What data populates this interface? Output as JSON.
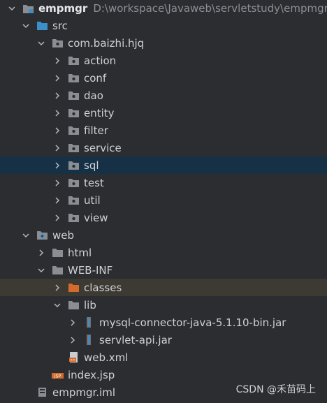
{
  "tree": {
    "project": {
      "label": "empmgr",
      "path": "D:\\workspace\\Javaweb\\servletstudy\\empmgr"
    },
    "src": {
      "label": "src"
    },
    "package": {
      "label": "com.baizhi.hjq"
    },
    "packages": [
      "action",
      "conf",
      "dao",
      "entity",
      "filter",
      "service",
      "sql",
      "test",
      "util",
      "view"
    ],
    "web": {
      "label": "web"
    },
    "html": {
      "label": "html"
    },
    "webinf": {
      "label": "WEB-INF"
    },
    "classes": {
      "label": "classes"
    },
    "lib": {
      "label": "lib"
    },
    "jars": [
      "mysql-connector-java-5.1.10-bin.jar",
      "servlet-api.jar"
    ],
    "webxml": {
      "label": "web.xml"
    },
    "indexjsp": {
      "label": "index.jsp"
    },
    "iml": {
      "label": "empmgr.iml"
    }
  },
  "watermark": "CSDN @禾苗码上",
  "colors": {
    "background": "#2b2d30",
    "selected_row": "#163046",
    "highlighted_row": "#3d3a34",
    "folder": "#8a8d92",
    "source_folder": "#3c8fc9",
    "excluded_folder": "#d46b2c"
  },
  "icons": {
    "chevron_right": "chevron-right-icon",
    "chevron_down": "chevron-down-icon",
    "module": "module-icon",
    "source_folder": "source-folder-icon",
    "package": "package-icon",
    "web_folder": "web-folder-icon",
    "folder": "folder-icon",
    "excluded_folder": "excluded-folder-icon",
    "jar": "jar-icon",
    "xml_file": "xml-file-icon",
    "jsp_file": "jsp-file-icon",
    "iml_file": "iml-file-icon"
  }
}
